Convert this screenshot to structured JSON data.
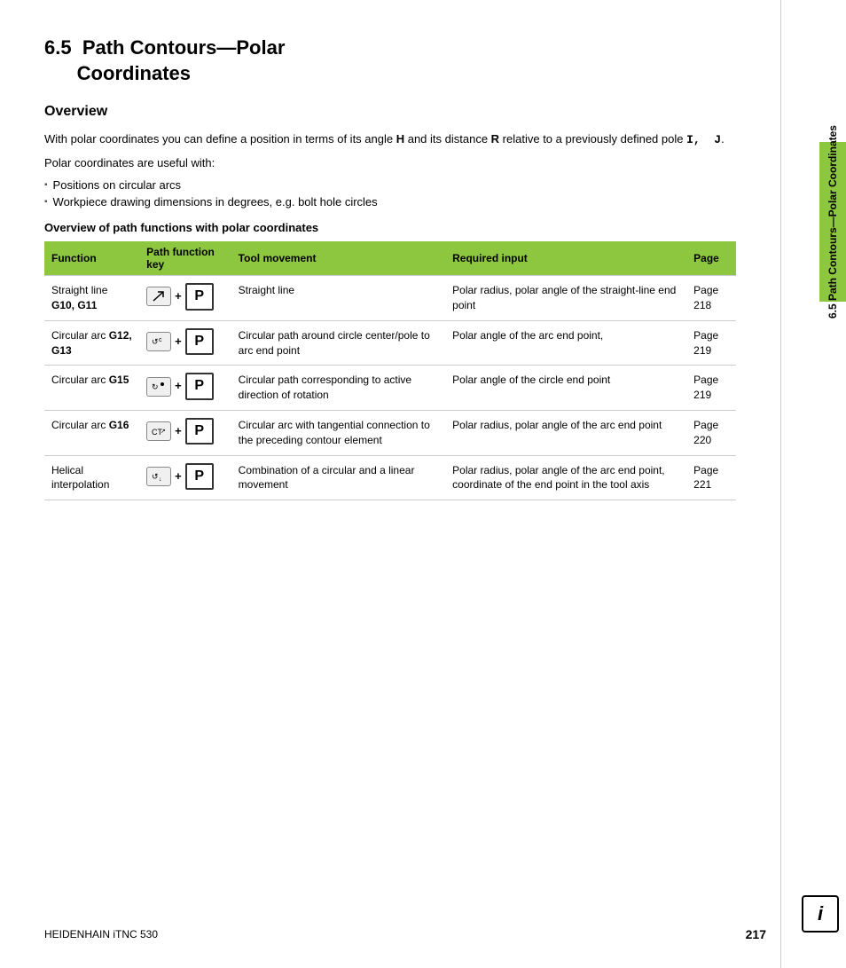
{
  "page": {
    "title": "6.5  Path Contours—Polar\n     Coordinates",
    "section_number": "6.5",
    "section_title": "Path Contours—Polar Coordinates",
    "footer_brand": "HEIDENHAIN iTNC 530",
    "page_number": "217",
    "sidebar_label": "6.5  Path Contours—Polar Coordinates"
  },
  "overview": {
    "heading": "Overview",
    "intro1": "With polar coordinates you can define a position in terms of its angle",
    "intro1_bold": "H",
    "intro1_cont": " and its distance ",
    "intro1_bold2": "R",
    "intro1_cont2": " relative to a previously defined pole ",
    "intro1_code": "I,  J",
    "intro1_end": ".",
    "intro2": "Polar coordinates are useful with:",
    "bullets": [
      "Positions on circular arcs",
      "Workpiece drawing dimensions in degrees, e.g. bolt hole circles"
    ],
    "table_heading": "Overview of path functions with polar coordinates"
  },
  "table": {
    "headers": [
      "Function",
      "Path function key",
      "Tool movement",
      "Required input",
      "Page"
    ],
    "rows": [
      {
        "function": "Straight line G10, G11",
        "key_type": "diagonal-arrow",
        "tool_movement": "Straight line",
        "required_input": "Polar radius, polar angle of the straight-line end point",
        "page": "Page 218"
      },
      {
        "function": "Circular arc G12, G13",
        "key_type": "arc-ccw",
        "tool_movement": "Circular path around circle center/pole to arc end point",
        "required_input": "Polar angle of the arc end point,",
        "page": "Page 219"
      },
      {
        "function": "Circular arc G15",
        "key_type": "arc-cw-dot",
        "tool_movement": "Circular path corresponding to active direction of rotation",
        "required_input": "Polar angle of the circle end point",
        "page": "Page 219"
      },
      {
        "function": "Circular arc G16",
        "key_type": "arc-tangent",
        "tool_movement": "Circular arc with tangential connection to the preceding contour element",
        "required_input": "Polar radius, polar angle of the arc end point",
        "page": "Page 220"
      },
      {
        "function": "Helical interpolation",
        "key_type": "arc-ccw",
        "tool_movement": "Combination of a circular and a linear movement",
        "required_input": "Polar radius, polar angle of the arc end point, coordinate of the end point in the tool axis",
        "page": "Page 221"
      }
    ]
  }
}
